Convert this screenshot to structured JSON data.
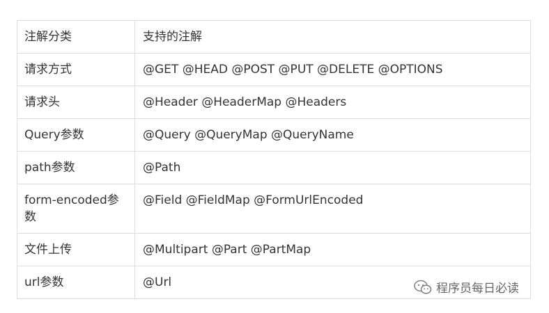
{
  "table": {
    "header": {
      "category": "注解分类",
      "annotations": "支持的注解"
    },
    "rows": [
      {
        "category": "请求方式",
        "annotations": "@GET @HEAD @POST @PUT @DELETE @OPTIONS"
      },
      {
        "category": "请求头",
        "annotations": "@Header @HeaderMap @Headers"
      },
      {
        "category": "Query参数",
        "annotations": "@Query @QueryMap @QueryName"
      },
      {
        "category": "path参数",
        "annotations": "@Path"
      },
      {
        "category": "form-encoded参数",
        "annotations": "@Field @FieldMap @FormUrlEncoded"
      },
      {
        "category": "文件上传",
        "annotations": "@Multipart @Part @PartMap"
      },
      {
        "category": "url参数",
        "annotations": "@Url"
      }
    ]
  },
  "watermark": {
    "icon": "wechat-icon",
    "text": "程序员每日必读"
  }
}
